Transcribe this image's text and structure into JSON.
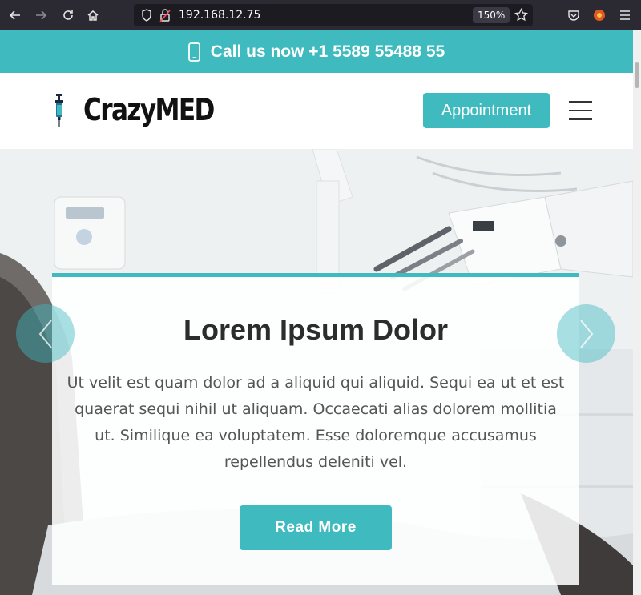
{
  "browser": {
    "url": "192.168.12.75",
    "zoom": "150%",
    "icons": [
      "back-icon",
      "forward-icon",
      "reload-icon",
      "home-icon",
      "shield-icon",
      "insecure-lock-icon",
      "star-icon",
      "pocket-icon",
      "extension-icon",
      "menu-icon"
    ]
  },
  "topbar": {
    "text": "Call us now +1 5589 55488 55",
    "icon": "phone-icon"
  },
  "header": {
    "logo_text": "CrazyMED",
    "logo_icon": "syringe-icon",
    "appointment_label": "Appointment",
    "menu_icon": "hamburger-icon"
  },
  "hero": {
    "title": "Lorem Ipsum Dolor",
    "text": "Ut velit est quam dolor ad a aliquid qui aliquid. Sequi ea ut et est quaerat sequi nihil ut aliquam. Occaecati alias dolorem mollitia ut. Similique ea voluptatem. Esse doloremque accusamus repellendus deleniti vel.",
    "button_label": "Read More",
    "prev_icon": "chevron-left-icon",
    "next_icon": "chevron-right-icon"
  },
  "colors": {
    "accent": "#3fbbc0",
    "chrome": "#2b2a33",
    "heading": "#2c2c2c",
    "body_text": "#555555"
  }
}
